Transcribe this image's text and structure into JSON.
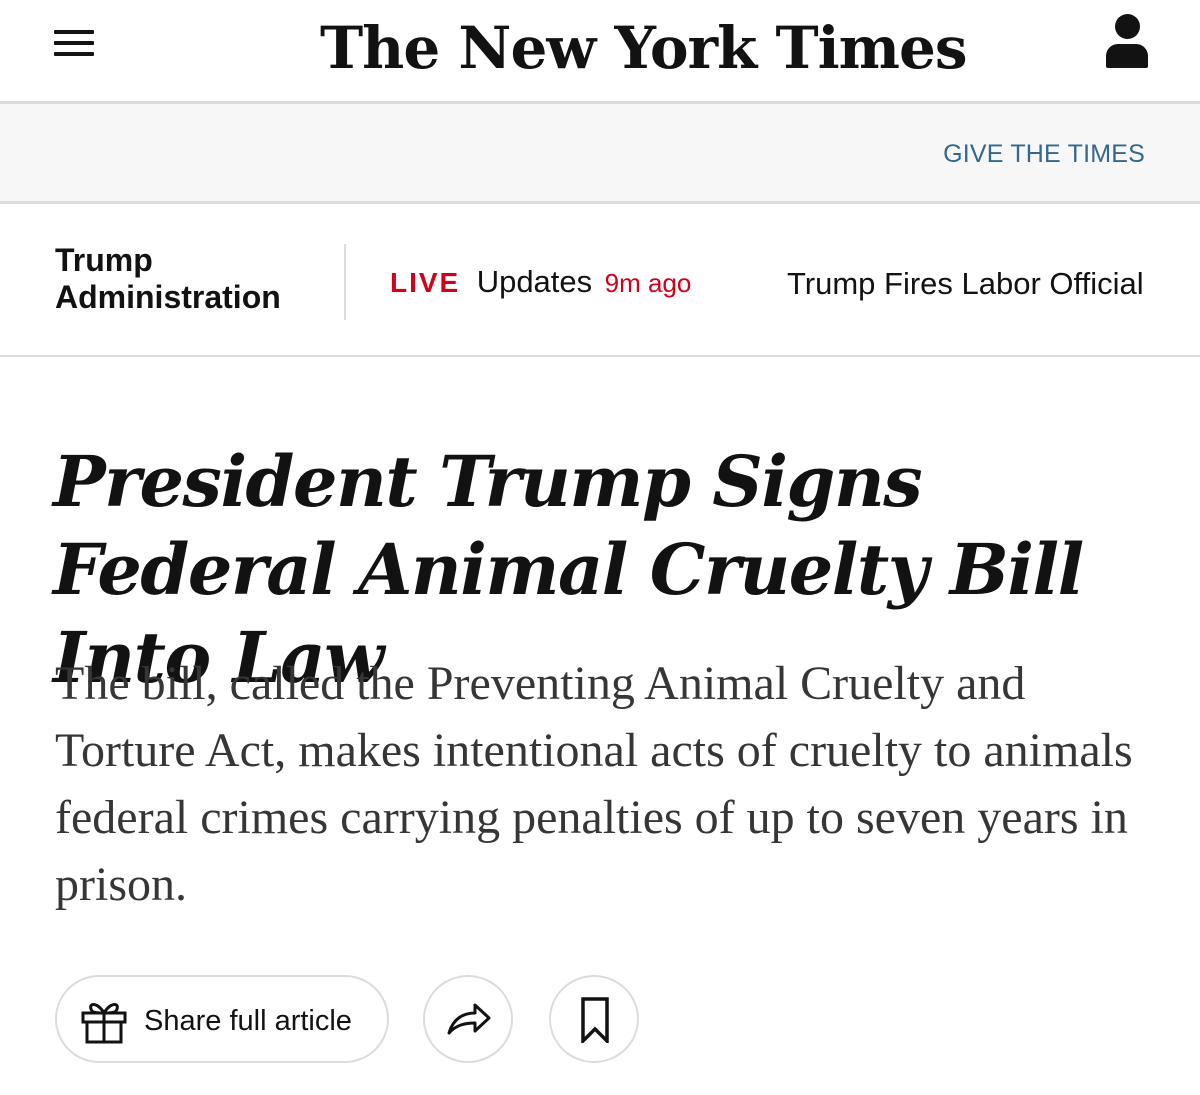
{
  "masthead": {
    "logo_text": "The New York Times",
    "menu_icon": "hamburger-menu-icon",
    "account_icon": "user-account-icon"
  },
  "give_bar": {
    "link_label": "GIVE THE TIMES",
    "link_color": "#326891"
  },
  "section_bar": {
    "section_label": "Trump Administration",
    "live_tag": "LIVE",
    "live_label": "Updates",
    "live_time": "9m ago",
    "live_color": "#d0021b",
    "story_link": "Trump Fires Labor Official"
  },
  "article": {
    "headline": "President Trump Signs Federal Animal Cruelty Bill Into Law",
    "summary": "The bill, called the Preventing Animal Cruelty and Torture Act, makes intentional acts of cruelty to animals federal crimes carrying penalties of up to seven years in prison."
  },
  "actions": {
    "share_label": "Share full article",
    "share_icon": "gift-icon",
    "forward_icon": "share-arrow-icon",
    "save_icon": "bookmark-icon"
  }
}
